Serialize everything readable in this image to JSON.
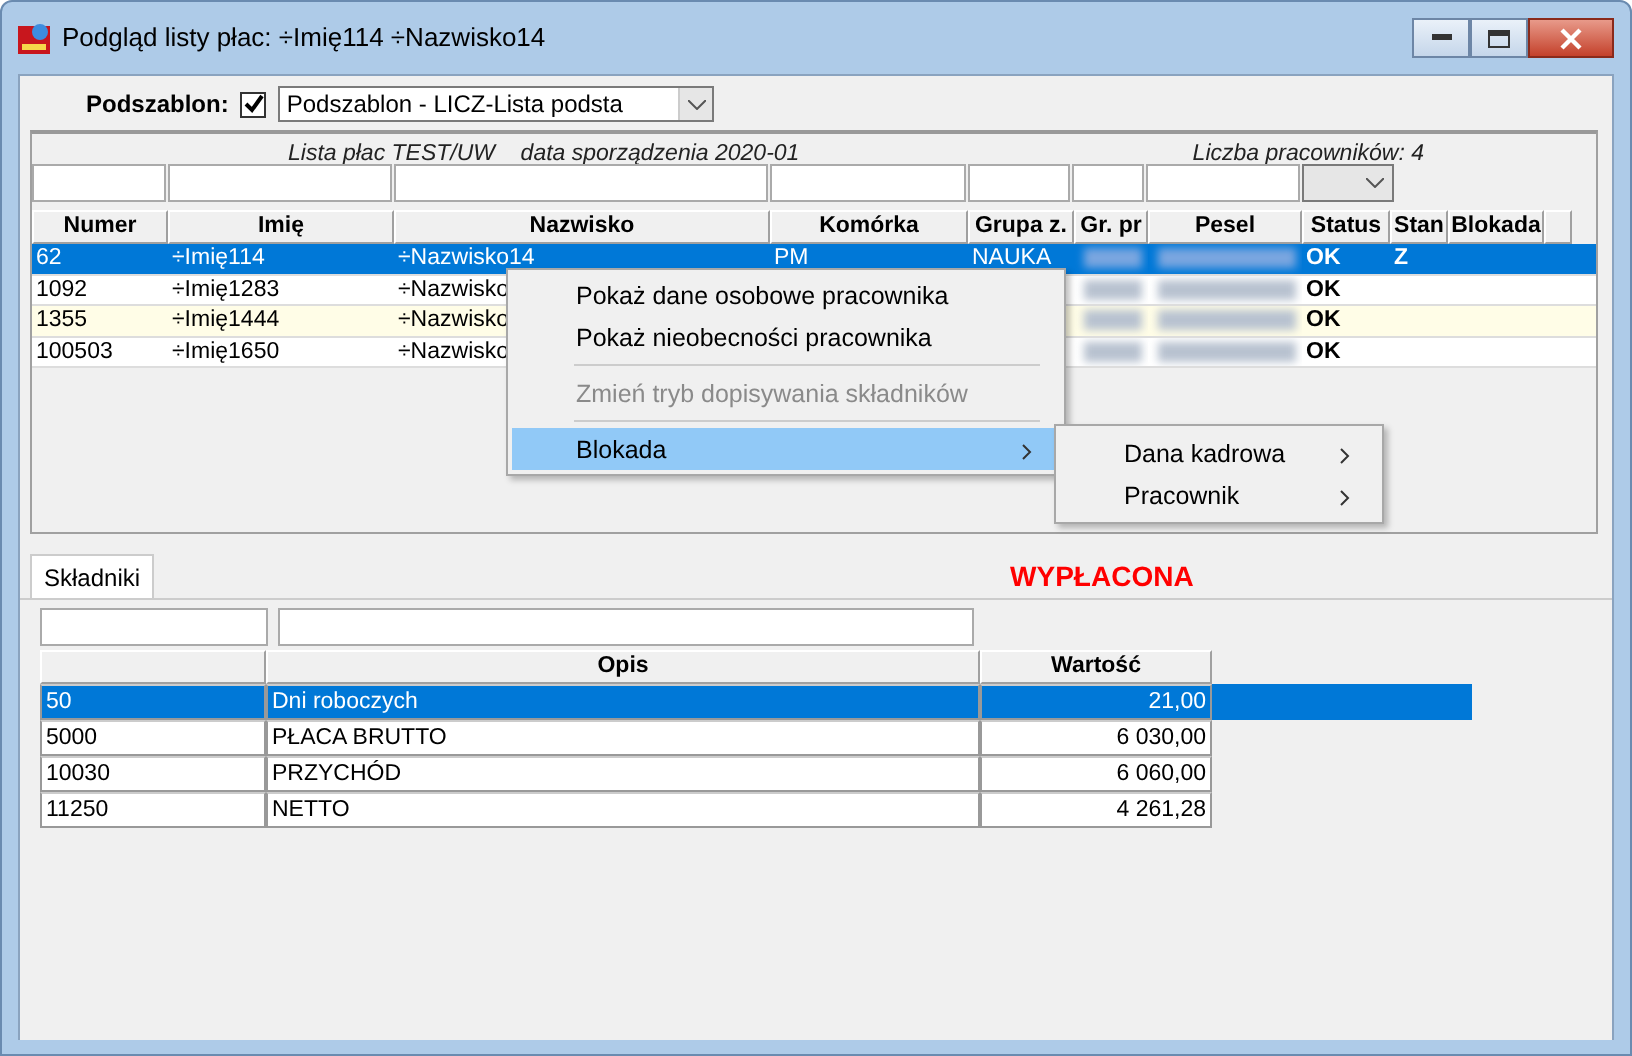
{
  "window": {
    "title": "Podgląd listy płac: ÷Imię114 ÷Nazwisko14"
  },
  "podszablon": {
    "label": "Podszablon:",
    "checked": true,
    "value": "Podszablon - LICZ-Lista podsta"
  },
  "employees": {
    "caption": "Lista płac TEST/UW    data sporządzenia 2020-01",
    "count": "Liczba pracowników: 4",
    "columns": [
      "Numer",
      "Imię",
      "Nazwisko",
      "Komórka",
      "Grupa z.",
      "Gr. pr",
      "Pesel",
      "Status",
      "Stan",
      "Blokada"
    ],
    "rows": [
      {
        "selected": true,
        "shaded": false,
        "cells": [
          "62",
          "÷Imię114",
          "÷Nazwisko14",
          "PM",
          "NAUKA",
          null,
          null,
          "OK",
          "Z",
          null
        ]
      },
      {
        "selected": false,
        "shaded": false,
        "cells": [
          "1092",
          "÷Imię1283",
          "÷Nazwisko",
          null,
          null,
          null,
          null,
          "OK",
          null,
          null
        ]
      },
      {
        "selected": false,
        "shaded": true,
        "cells": [
          "1355",
          "÷Imię1444",
          "÷Nazwisko",
          null,
          null,
          null,
          null,
          "OK",
          null,
          null
        ]
      },
      {
        "selected": false,
        "shaded": false,
        "cells": [
          "100503",
          "÷Imię1650",
          "÷Nazwisko",
          null,
          null,
          null,
          null,
          "OK",
          null,
          null
        ]
      }
    ]
  },
  "context_menu": {
    "items": [
      {
        "kind": "item",
        "label": "Pokaż dane osobowe pracownika",
        "disabled": false,
        "selected": false
      },
      {
        "kind": "item",
        "label": "Pokaż nieobecności pracownika",
        "disabled": false,
        "selected": false
      },
      {
        "kind": "separator"
      },
      {
        "kind": "item",
        "label": "Zmień tryb dopisywania składników",
        "disabled": true,
        "selected": false
      },
      {
        "kind": "separator"
      },
      {
        "kind": "submenu",
        "label": "Blokada",
        "disabled": false,
        "selected": true
      }
    ],
    "submenu": [
      {
        "label": "Dana kadrowa"
      },
      {
        "label": "Pracownik"
      }
    ]
  },
  "tabs": [
    {
      "label": "Składniki",
      "selected": true
    }
  ],
  "status_label": "WYPŁACONA",
  "components": {
    "columns": [
      "Opis",
      "Wartość"
    ],
    "rows": [
      {
        "selected": true,
        "cells": [
          "50",
          "Dni roboczych",
          "21,00"
        ]
      },
      {
        "selected": false,
        "cells": [
          "5000",
          "PŁACA BRUTTO",
          "6 030,00"
        ]
      },
      {
        "selected": false,
        "cells": [
          "10030",
          "PRZYCHÓD",
          "6 060,00"
        ]
      },
      {
        "selected": false,
        "cells": [
          "11250",
          "NETTO",
          "4 261,28"
        ]
      }
    ]
  }
}
